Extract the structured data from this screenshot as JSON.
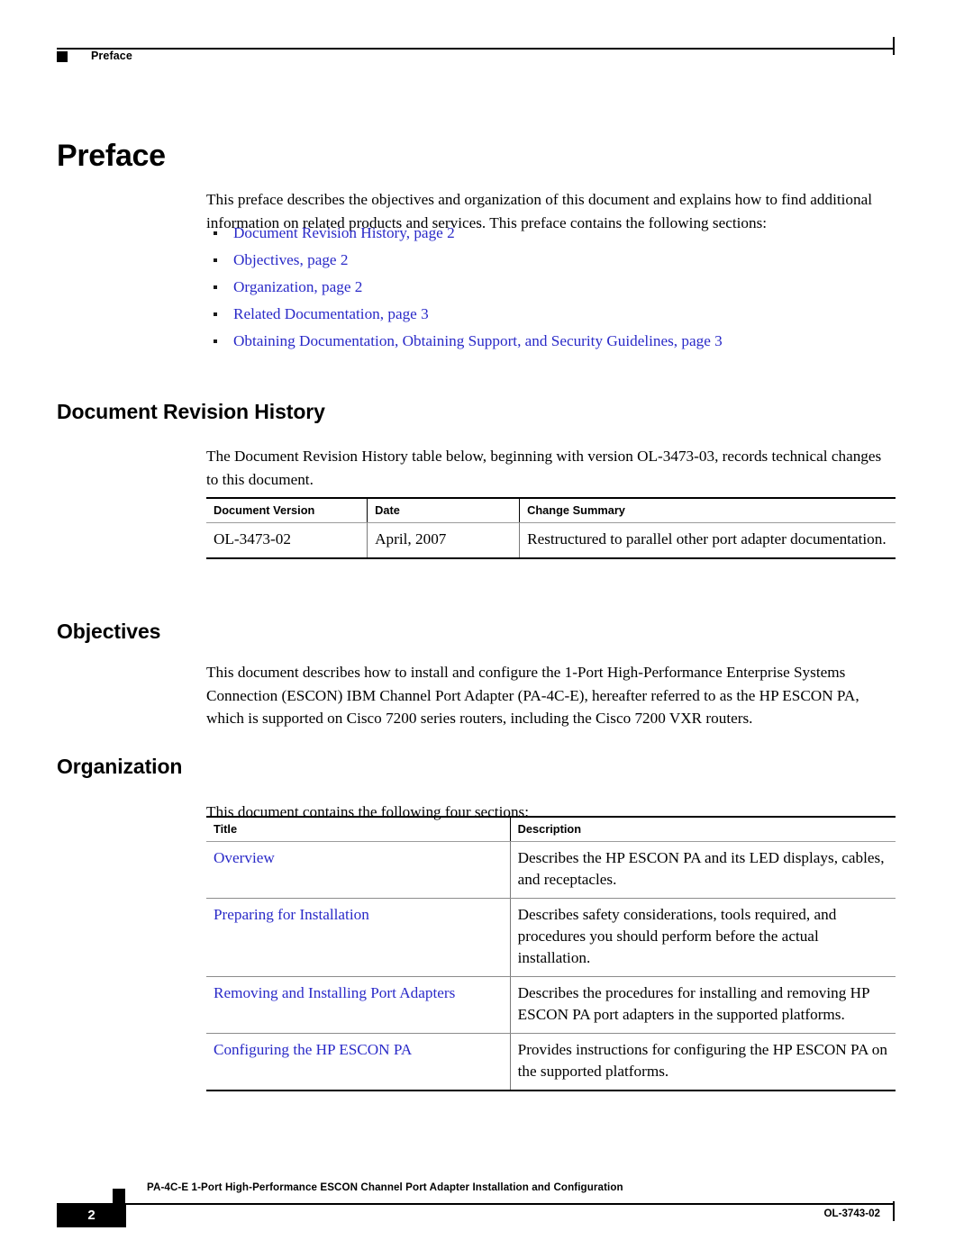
{
  "header": {
    "running_title": "Preface"
  },
  "chapter": {
    "title": "Preface",
    "intro": "This preface describes the objectives and organization of this document and explains how to find additional information on related products and services. This preface contains the following sections:"
  },
  "toc_links": [
    {
      "label": "Document Revision History, page 2"
    },
    {
      "label": "Objectives, page 2"
    },
    {
      "label": "Organization, page 2"
    },
    {
      "label": "Related Documentation, page 3"
    },
    {
      "label": "Obtaining Documentation, Obtaining Support, and Security Guidelines, page 3"
    }
  ],
  "sections": {
    "revision": {
      "heading": "Document Revision History",
      "paragraph": "The Document Revision History table below, beginning with version OL-3473-03, records technical changes to this document.",
      "table": {
        "columns": [
          "Document Version",
          "Date",
          "Change Summary"
        ],
        "rows": [
          [
            "OL-3473-02",
            "April, 2007",
            "Restructured to parallel other port adapter documentation."
          ]
        ]
      }
    },
    "objectives": {
      "heading": "Objectives",
      "paragraph": "This document describes how to install and configure the 1-Port High-Performance Enterprise Systems Connection (ESCON) IBM Channel Port Adapter (PA-4C-E), hereafter referred to as the HP ESCON PA, which is supported on Cisco 7200 series routers, including the Cisco 7200 VXR routers."
    },
    "organization": {
      "heading": "Organization",
      "paragraph": "This document contains the following four sections:",
      "table": {
        "columns": [
          "Title",
          "Description"
        ],
        "rows": [
          {
            "title": "Overview",
            "description": "Describes the HP ESCON PA and its LED displays, cables, and receptacles."
          },
          {
            "title": "Preparing for Installation",
            "description": "Describes safety considerations, tools required, and procedures you should perform before the actual installation."
          },
          {
            "title": "Removing and Installing Port Adapters",
            "description": "Describes the procedures for installing and removing HP ESCON PA port adapters in the supported platforms."
          },
          {
            "title": "Configuring the HP ESCON PA",
            "description": "Provides instructions for configuring the HP ESCON PA on the supported platforms."
          }
        ]
      }
    }
  },
  "footer": {
    "document_title": "PA-4C-E 1-Port High-Performance ESCON Channel Port Adapter Installation and Configuration",
    "page_number": "2",
    "doc_id": "OL-3743-02"
  },
  "colors": {
    "link": "#2a2ac8",
    "text": "#000000",
    "rule": "#000000",
    "table_sep": "#8c8c8c"
  }
}
